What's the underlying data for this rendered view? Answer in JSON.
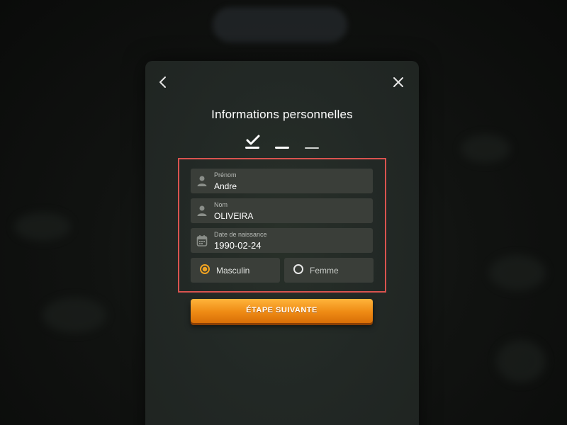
{
  "dialog": {
    "title": "Informations personnelles",
    "steps": [
      {
        "state": "completed",
        "icon": "check-icon"
      },
      {
        "state": "current"
      },
      {
        "state": "upcoming"
      }
    ]
  },
  "form": {
    "first_name": {
      "label": "Prénom",
      "value": "Andre",
      "icon": "user-icon"
    },
    "last_name": {
      "label": "Nom",
      "value": "OLIVEIRA",
      "icon": "user-icon"
    },
    "birth_date": {
      "label": "Date de naissance",
      "value": "1990-02-24",
      "icon": "calendar-icon"
    },
    "gender": {
      "options": [
        {
          "label": "Masculin",
          "selected": true
        },
        {
          "label": "Femme",
          "selected": false
        }
      ]
    }
  },
  "actions": {
    "next_label": "ÉTAPE SUIVANTE",
    "back_icon": "chevron-left-icon",
    "close_icon": "close-icon"
  },
  "colors": {
    "accent": "#f0a322",
    "highlight_border": "#d9534f",
    "panel": "#252b27",
    "field": "#3a3e39"
  }
}
